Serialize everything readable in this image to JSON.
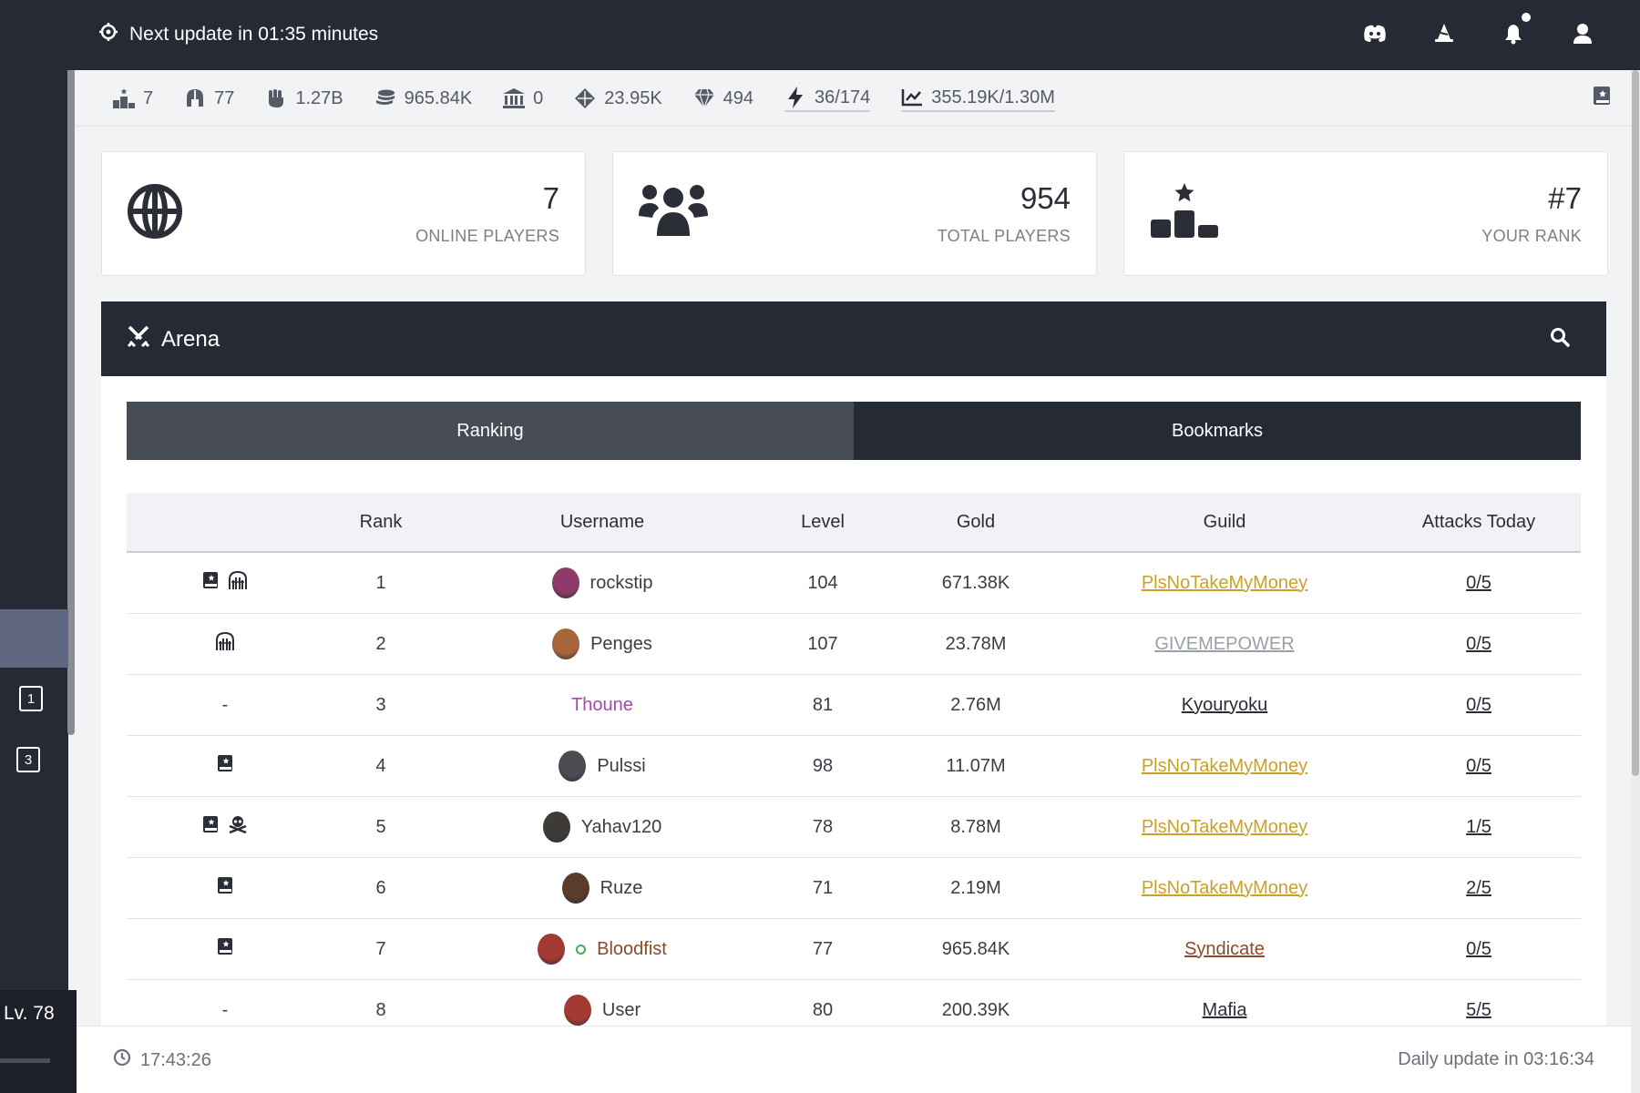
{
  "topbar": {
    "update_text": "Next update in 01:35 minutes",
    "icons": [
      "discord-icon",
      "wizard-hat-icon",
      "bell-icon",
      "user-icon"
    ]
  },
  "sidebar": {
    "badges": [
      "1",
      "3"
    ],
    "level": "Lv. 78"
  },
  "resources": [
    {
      "icon": "podium-icon",
      "value": "7"
    },
    {
      "icon": "helmet-icon",
      "value": "77"
    },
    {
      "icon": "fist-icon",
      "value": "1.27B"
    },
    {
      "icon": "coins-icon",
      "value": "965.84K"
    },
    {
      "icon": "bank-icon",
      "value": "0"
    },
    {
      "icon": "crystal-icon",
      "value": "23.95K"
    },
    {
      "icon": "gem-icon",
      "value": "494"
    },
    {
      "icon": "lightning-icon",
      "value": "36/174"
    },
    {
      "icon": "chart-icon",
      "value": "355.19K/1.30M"
    }
  ],
  "stats": [
    {
      "value": "7",
      "label": "ONLINE PLAYERS",
      "icon": "globe-icon"
    },
    {
      "value": "954",
      "label": "TOTAL PLAYERS",
      "icon": "users-icon"
    },
    {
      "value": "#7",
      "label": "YOUR RANK",
      "icon": "podium-star-icon"
    }
  ],
  "arena": {
    "title": "Arena",
    "tabs": [
      "Ranking",
      "Bookmarks"
    ],
    "columns": [
      "",
      "Rank",
      "Username",
      "Level",
      "Gold",
      "Guild",
      "Attacks Today"
    ],
    "rows": [
      {
        "flags": [
          "bookmark",
          "gate"
        ],
        "rank": "1",
        "username": "rockstip",
        "level": "104",
        "gold": "671.38K",
        "guild": "PlsNoTakeMyMoney",
        "guild_color": "#c9a227",
        "attacks": "0/5",
        "avatar_color": "#8e3b6b",
        "name_color": "#3a3d45",
        "online": false
      },
      {
        "flags": [
          "gate"
        ],
        "rank": "2",
        "username": "Penges",
        "level": "107",
        "gold": "23.78M",
        "guild": "GIVEMEPOWER",
        "guild_color": "#9aa0a8",
        "attacks": "0/5",
        "avatar_color": "#a8653a",
        "name_color": "#3a3d45",
        "online": false
      },
      {
        "flags": [],
        "dash": "-",
        "rank": "3",
        "username": "Thoune",
        "level": "81",
        "gold": "2.76M",
        "guild": "Kyouryoku",
        "guild_color": "#2b2e36",
        "attacks": "0/5",
        "avatar_color": "",
        "name_color": "#a44aa6",
        "online": false
      },
      {
        "flags": [
          "bookmark"
        ],
        "rank": "4",
        "username": "Pulssi",
        "level": "98",
        "gold": "11.07M",
        "guild": "PlsNoTakeMyMoney",
        "guild_color": "#c9a227",
        "attacks": "0/5",
        "avatar_color": "#4a4c52",
        "name_color": "#3a3d45",
        "online": false
      },
      {
        "flags": [
          "bookmark",
          "skull"
        ],
        "rank": "5",
        "username": "Yahav120",
        "level": "78",
        "gold": "8.78M",
        "guild": "PlsNoTakeMyMoney",
        "guild_color": "#c9a227",
        "attacks": "1/5",
        "avatar_color": "#3d3a38",
        "name_color": "#3a3d45",
        "online": false
      },
      {
        "flags": [
          "bookmark"
        ],
        "rank": "6",
        "username": "Ruze",
        "level": "71",
        "gold": "2.19M",
        "guild": "PlsNoTakeMyMoney",
        "guild_color": "#c9a227",
        "attacks": "2/5",
        "avatar_color": "#5b3b2a",
        "name_color": "#3a3d45",
        "online": false
      },
      {
        "flags": [
          "bookmark"
        ],
        "rank": "7",
        "username": "Bloodfist",
        "level": "77",
        "gold": "965.84K",
        "guild": "Syndicate",
        "guild_color": "#8a4a2a",
        "attacks": "0/5",
        "avatar_color": "#a33b32",
        "name_color": "#8a4a2a",
        "online": true
      },
      {
        "flags": [],
        "dash": "-",
        "rank": "8",
        "username": "User",
        "level": "80",
        "gold": "200.39K",
        "guild": "Mafia",
        "guild_color": "#2b2e36",
        "attacks": "5/5",
        "avatar_color": "#a33b32",
        "name_color": "#3a3d45",
        "online": false
      }
    ]
  },
  "footer": {
    "time": "17:43:26",
    "daily": "Daily update in 03:16:34"
  }
}
